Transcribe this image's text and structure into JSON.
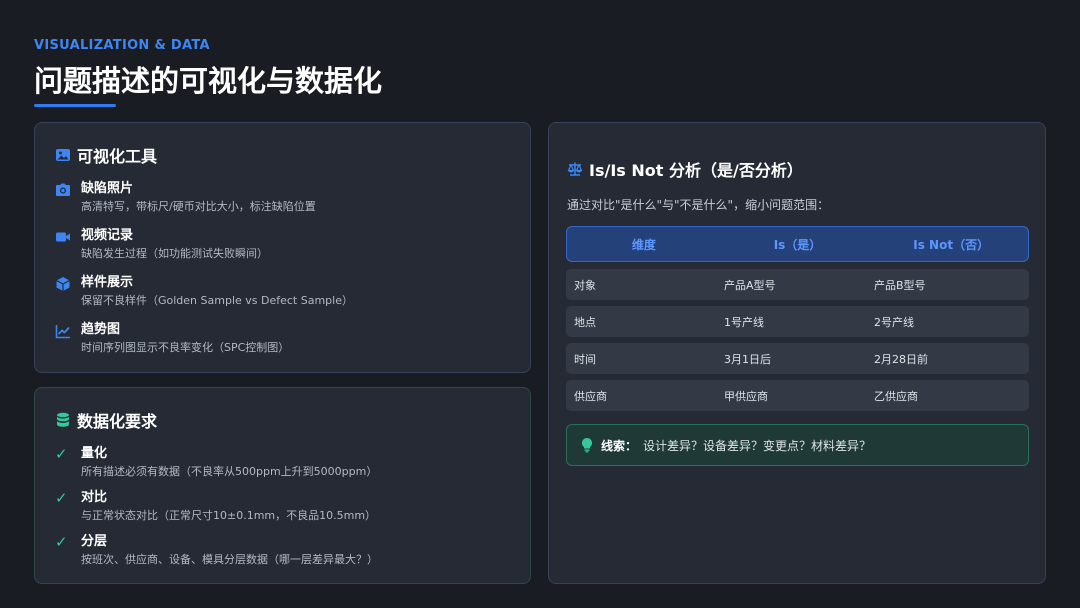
{
  "header": {
    "eyebrow": "VISUALIZATION & DATA",
    "title": "问题描述的可视化与数据化"
  },
  "tools": {
    "title": "可视化工具",
    "icon": "image-icon",
    "items": [
      {
        "icon": "camera-icon",
        "title": "缺陷照片",
        "desc": "高清特写，带标尺/硬币对比大小，标注缺陷位置"
      },
      {
        "icon": "video-icon",
        "title": "视频记录",
        "desc": "缺陷发生过程（如功能测试失败瞬间）"
      },
      {
        "icon": "cube-icon",
        "title": "样件展示",
        "desc": "保留不良样件（Golden Sample vs Defect Sample）"
      },
      {
        "icon": "trend-chart-icon",
        "title": "趋势图",
        "desc": "时间序列图显示不良率变化（SPC控制图）"
      }
    ]
  },
  "data_req": {
    "title": "数据化要求",
    "icon": "database-icon",
    "check_mark": "✓",
    "items": [
      {
        "title": "量化",
        "desc": "所有描述必须有数据（不良率从500ppm上升到5000ppm）"
      },
      {
        "title": "对比",
        "desc": "与正常状态对比（正常尺寸10±0.1mm，不良品10.5mm）"
      },
      {
        "title": "分层",
        "desc": "按班次、供应商、设备、模具分层数据（哪一层差异最大？）"
      }
    ]
  },
  "isnot": {
    "title": "Is/Is Not 分析（是/否分析）",
    "icon": "scale-icon",
    "intro": "通过对比\"是什么\"与\"不是什么\"，缩小问题范围：",
    "columns": [
      "维度",
      "Is（是）",
      "Is Not（否）"
    ],
    "rows": [
      [
        "对象",
        "产品A型号",
        "产品B型号"
      ],
      [
        "地点",
        "1号产线",
        "2号产线"
      ],
      [
        "时间",
        "3月1日后",
        "2月28日前"
      ],
      [
        "供应商",
        "甲供应商",
        "乙供应商"
      ]
    ],
    "clue_label": "线索：",
    "clue_text": "设计差异？设备差异？变更点？材料差异？"
  },
  "colors": {
    "accent_blue": "#3d86f4",
    "accent_green": "#35c89a",
    "background": "#191c22"
  }
}
